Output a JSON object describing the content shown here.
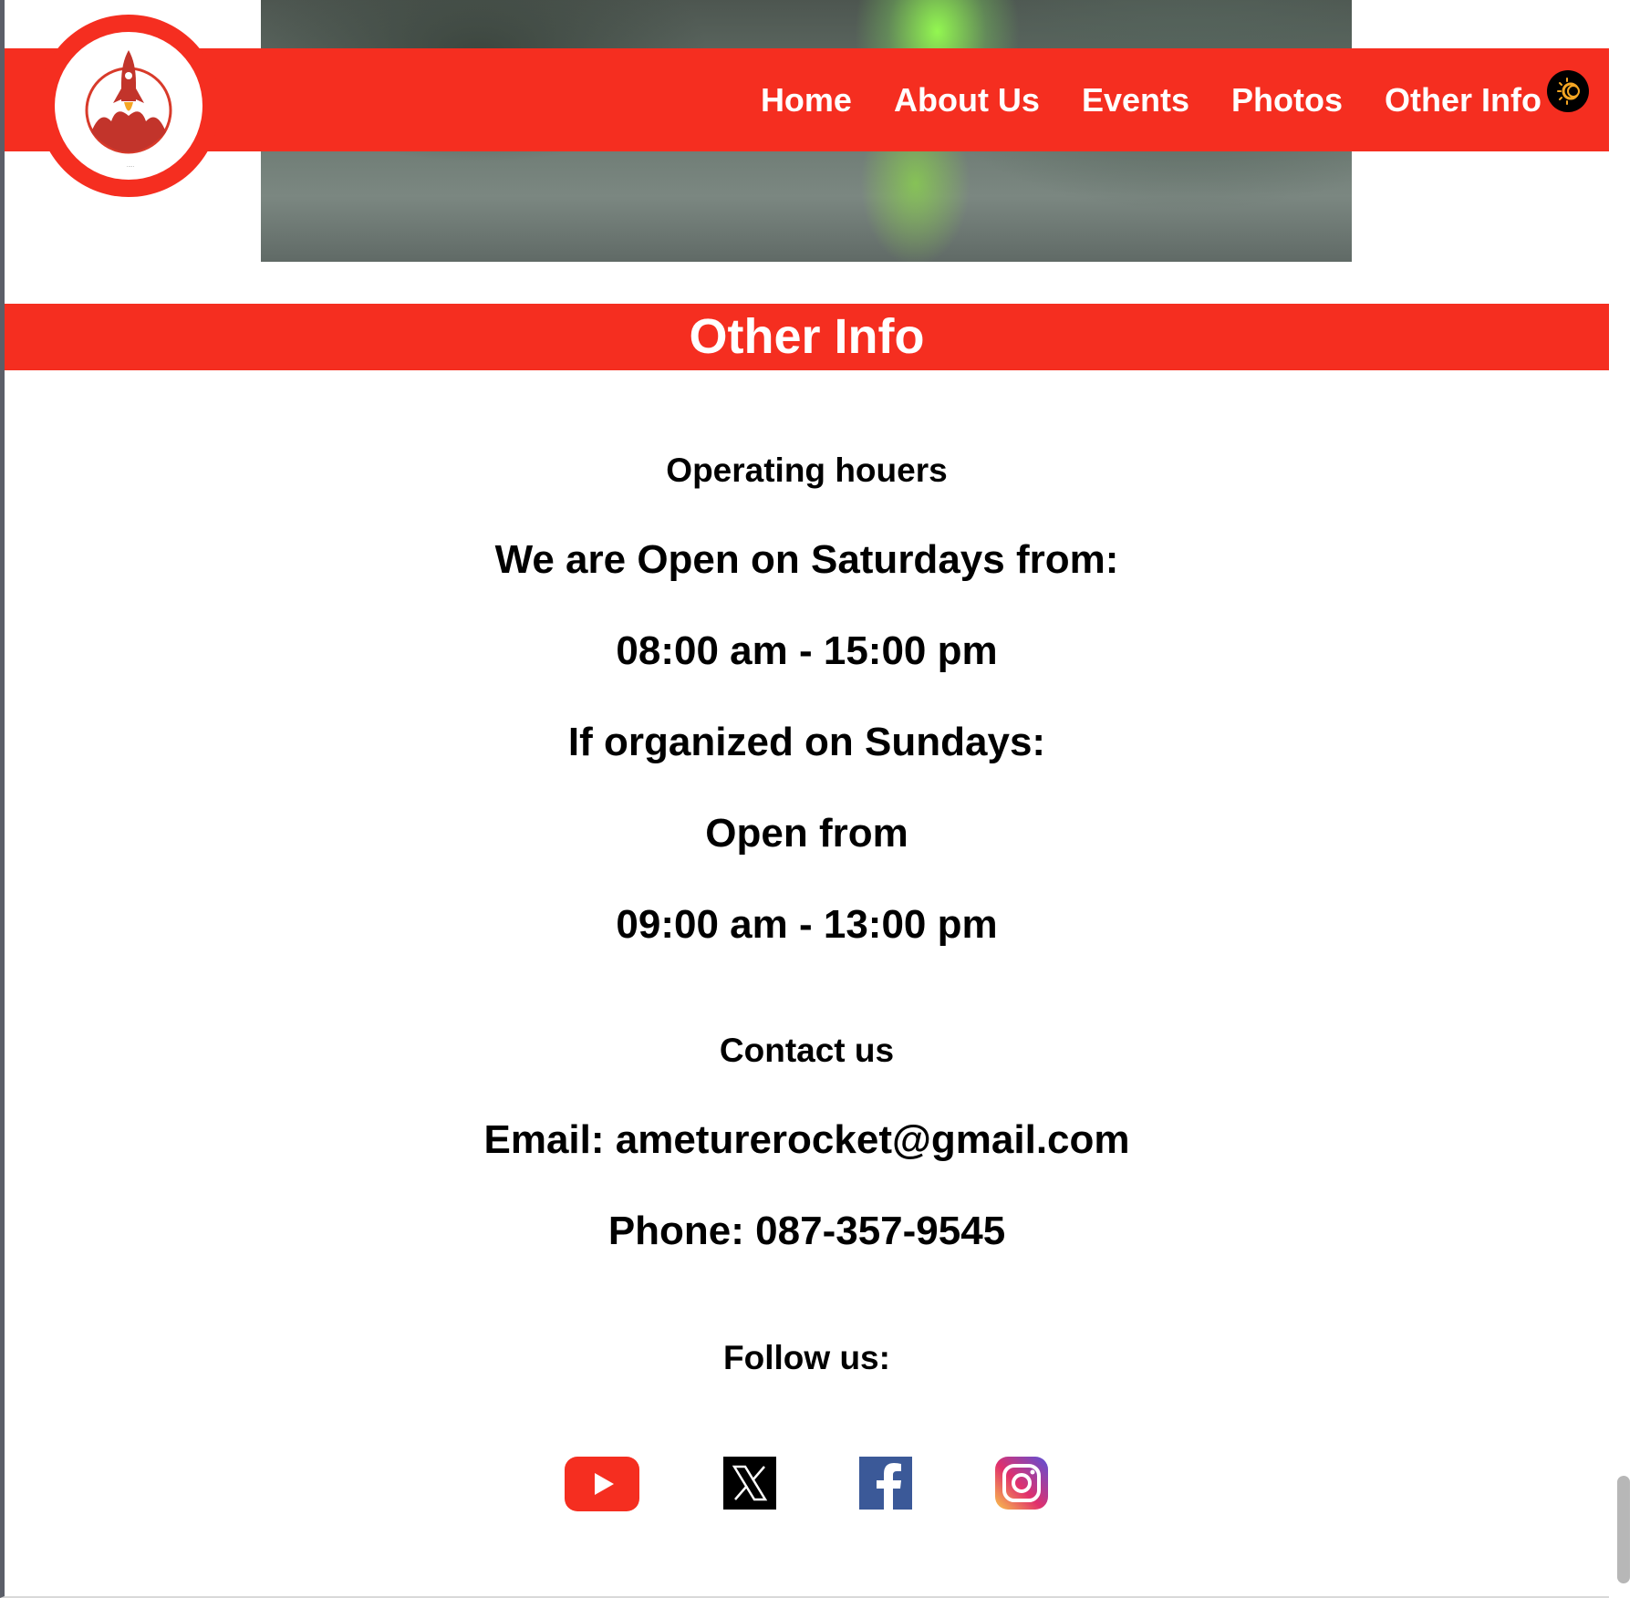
{
  "nav": {
    "items": [
      {
        "label": "Home"
      },
      {
        "label": "About Us"
      },
      {
        "label": "Events"
      },
      {
        "label": "Photos"
      },
      {
        "label": "Other Info"
      }
    ],
    "theme_toggle_icon": "sun-moon-icon"
  },
  "logo": {
    "icon": "rocket-icon"
  },
  "section": {
    "title": "Other Info"
  },
  "hours": {
    "heading": "Operating houers",
    "line1": "We are Open on Saturdays from:",
    "line2": "08:00 am - 15:00 pm",
    "line3": "If organized on Sundays:",
    "line4": "Open from",
    "line5": "09:00 am - 13:00 pm"
  },
  "contact": {
    "heading": "Contact us",
    "email": "Email: ameturerocket@gmail.com",
    "phone": "Phone: 087-357-9545"
  },
  "follow": {
    "heading": "Follow us:",
    "icons": [
      "youtube-icon",
      "x-icon",
      "facebook-icon",
      "instagram-icon"
    ]
  },
  "colors": {
    "accent": "#f52e20",
    "text": "#000000",
    "background": "#ffffff"
  }
}
